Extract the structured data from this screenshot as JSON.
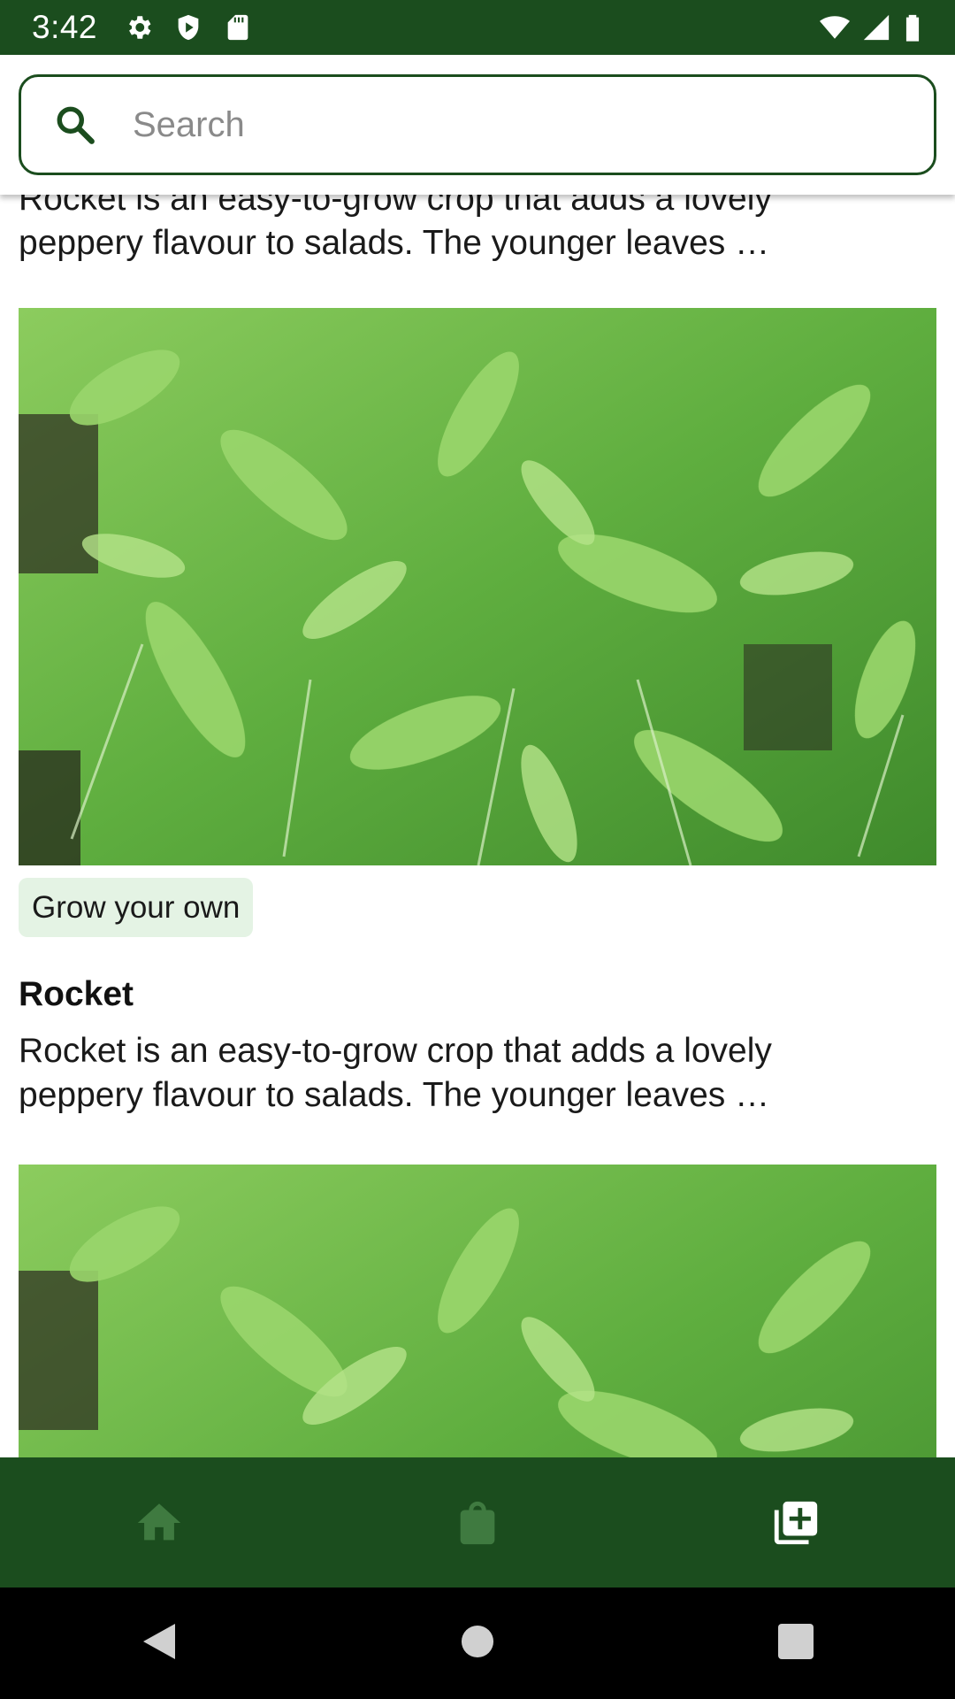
{
  "status_bar": {
    "time": "3:42",
    "left_icons": [
      "gear-icon",
      "shield-play-icon",
      "sd-card-icon"
    ],
    "right_icons": [
      "wifi-icon",
      "signal-icon",
      "battery-icon"
    ]
  },
  "search": {
    "placeholder": "Search",
    "value": ""
  },
  "feed": {
    "partial_description": "Rocket is an easy-to-grow crop that adds a lovely peppery flavour to salads. The younger leaves …",
    "cards": [
      {
        "image_alt": "rocket leaves",
        "tag": "Grow your own",
        "title": "Rocket",
        "description": "Rocket is an easy-to-grow crop that adds a lovely peppery flavour to salads. The younger leaves …"
      },
      {
        "image_alt": "rocket leaves"
      }
    ]
  },
  "bottom_nav": {
    "items": [
      {
        "icon": "home-icon",
        "active": false
      },
      {
        "icon": "shopping-bag-icon",
        "active": false
      },
      {
        "icon": "add-box-icon",
        "active": true
      }
    ],
    "colors": {
      "background": "#1b4d1e",
      "inactive": "#3f7a40",
      "active": "#ffffff"
    }
  },
  "system_nav": {
    "buttons": [
      "back-icon",
      "home-circle-icon",
      "recents-icon"
    ]
  }
}
